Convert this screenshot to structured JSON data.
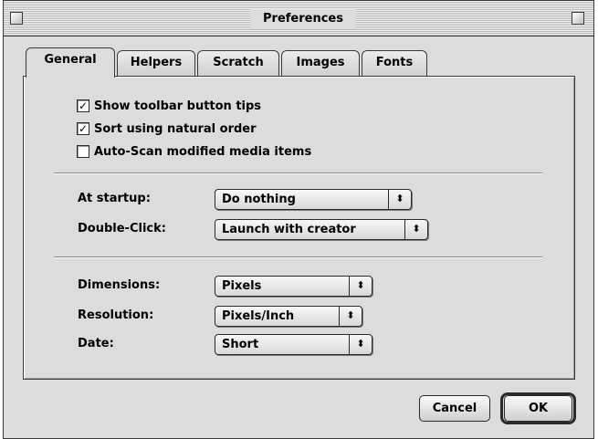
{
  "window": {
    "title": "Preferences"
  },
  "tabs": [
    {
      "label": "General",
      "active": true
    },
    {
      "label": "Helpers",
      "active": false
    },
    {
      "label": "Scratch",
      "active": false
    },
    {
      "label": "Images",
      "active": false
    },
    {
      "label": "Fonts",
      "active": false
    }
  ],
  "checkboxes": [
    {
      "label": "Show toolbar button tips",
      "checked": true,
      "mark": "☑"
    },
    {
      "label": "Sort using natural order",
      "checked": true,
      "mark": "☑"
    },
    {
      "label": "Auto-Scan modified media items",
      "checked": false,
      "mark": ""
    }
  ],
  "startup": {
    "at_startup_label": "At startup:",
    "at_startup_value": "Do nothing",
    "double_click_label": "Double-Click:",
    "double_click_value": "Launch with creator"
  },
  "units": {
    "dimensions_label": "Dimensions:",
    "dimensions_value": "Pixels",
    "resolution_label": "Resolution:",
    "resolution_value": "Pixels/Inch",
    "date_label": "Date:",
    "date_value": "Short"
  },
  "popup_arrow_glyph": "⬍",
  "buttons": {
    "cancel": "Cancel",
    "ok": "OK"
  }
}
